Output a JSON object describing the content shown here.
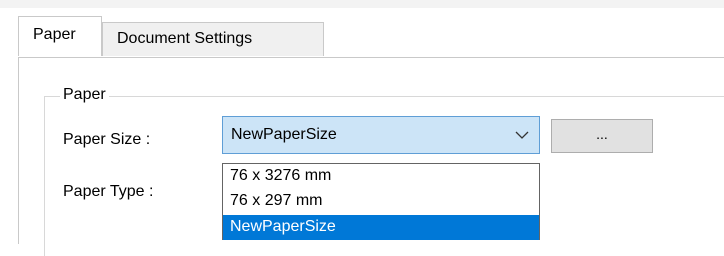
{
  "tabs": [
    {
      "label": "Paper",
      "active": true
    },
    {
      "label": "Document Settings",
      "active": false
    }
  ],
  "paper_group": {
    "title": "Paper",
    "paper_size_label": "Paper Size :",
    "paper_type_label": "Paper Type :",
    "paper_size_value": "NewPaperSize",
    "browse_button_label": "...",
    "dropdown_options": [
      {
        "label": "76 x 3276 mm",
        "selected": false
      },
      {
        "label": "76 x 297 mm",
        "selected": false
      },
      {
        "label": "NewPaperSize",
        "selected": true
      }
    ]
  },
  "icons": {
    "combo_arrow": "chevron-down-icon"
  },
  "colors": {
    "combo_focus_bg": "#cce4f7",
    "combo_focus_border": "#5f9ed6",
    "selection": "#0078d7",
    "button_bg": "#e1e1e1"
  }
}
